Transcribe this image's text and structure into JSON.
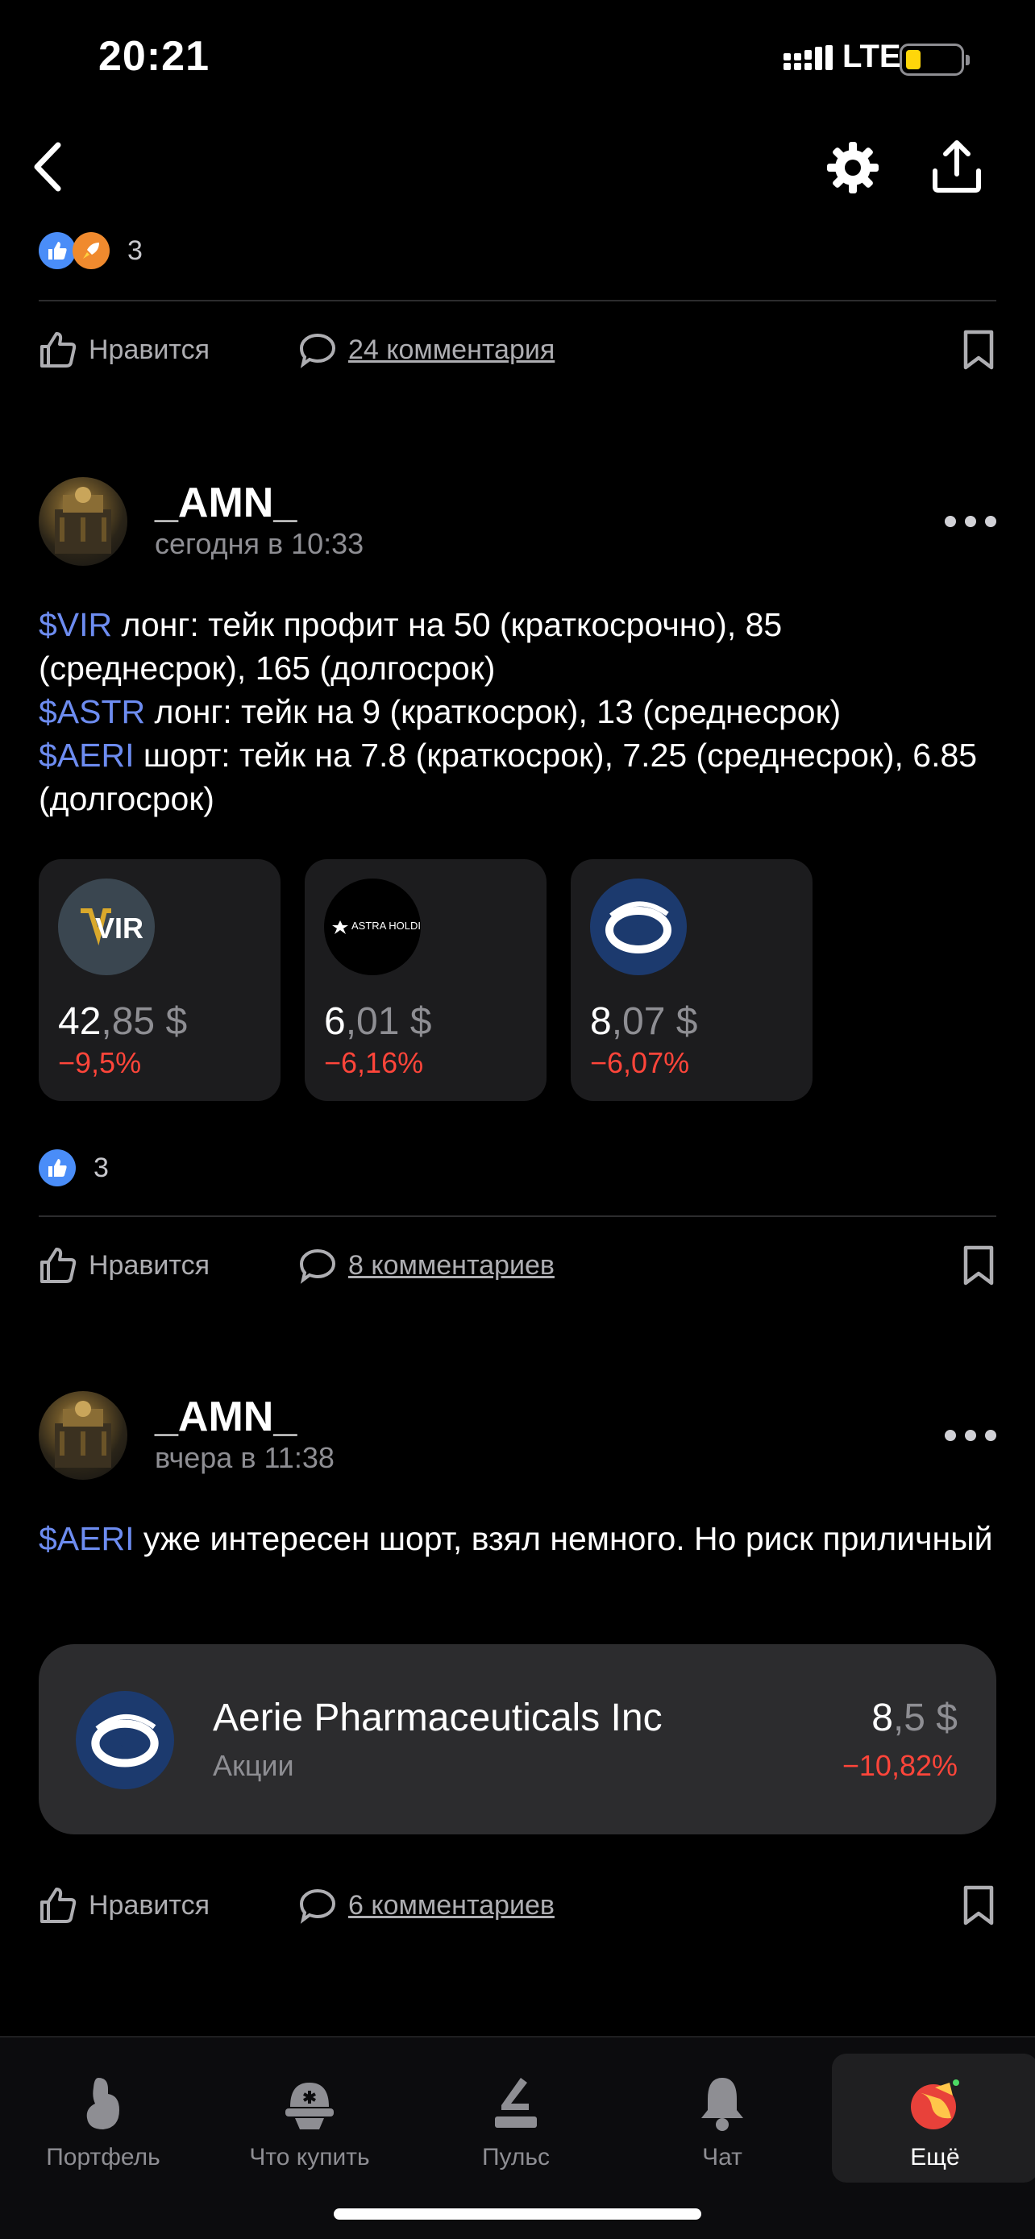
{
  "status_bar": {
    "time": "20:21",
    "network": "LTE"
  },
  "nav": {
    "back_icon": "chevron-left-icon",
    "settings_icon": "gear-icon",
    "share_icon": "share-icon"
  },
  "posts": [
    {
      "reactions_count": "3",
      "like_label": "Нравится",
      "comments_label": "24 комментария"
    },
    {
      "author": "_AMN_",
      "time": "сегодня в 10:33",
      "lines": [
        {
          "ticker": "$VIR",
          "text": " лонг: тейк профит на 50 (краткосрочно), 85 (среднесрок), 165 (долгосрок)"
        },
        {
          "ticker": "$ASTR",
          "text": " лонг: тейк на 9 (краткосрок), 13 (среднесрок)"
        },
        {
          "ticker": "$AERI",
          "text": " шорт: тейк на 7.8 (краткосрок), 7.25 (среднесрок), 6.85 (долгосрок)"
        }
      ],
      "cards": [
        {
          "logo": "VIR",
          "price_int": "42",
          "price_frac": ",85 $",
          "change": "−9,5%"
        },
        {
          "logo": "ASTRA HOLDINGS",
          "price_int": "6",
          "price_frac": ",01 $",
          "change": "−6,16%"
        },
        {
          "logo": "aerie-logo",
          "price_int": "8",
          "price_frac": ",07 $",
          "change": "−6,07%"
        }
      ],
      "reactions_count": "3",
      "like_label": "Нравится",
      "comments_label": "8 комментариев"
    },
    {
      "author": "_AMN_",
      "time": "вчера в 11:38",
      "ticker": "$AERI",
      "text": " уже интересен шорт, взял немного. Но риск приличный",
      "instrument": {
        "name": "Aerie Pharmaceuticals Inc",
        "type": "Акции",
        "price_int": "8",
        "price_frac": ",5 $",
        "change": "−10,82%"
      },
      "like_label": "Нравится",
      "comments_label": "6 комментариев"
    }
  ],
  "tabs": [
    {
      "label": "Портфель",
      "icon": "portfolio-icon"
    },
    {
      "label": "Что купить",
      "icon": "what-to-buy-icon"
    },
    {
      "label": "Пульс",
      "icon": "pulse-icon"
    },
    {
      "label": "Чат",
      "icon": "chat-bell-icon"
    },
    {
      "label": "Ещё",
      "icon": "more-icon",
      "active": true
    }
  ],
  "colors": {
    "ticker": "#6d8cf0",
    "negative": "#ff453a",
    "background": "#000000"
  }
}
